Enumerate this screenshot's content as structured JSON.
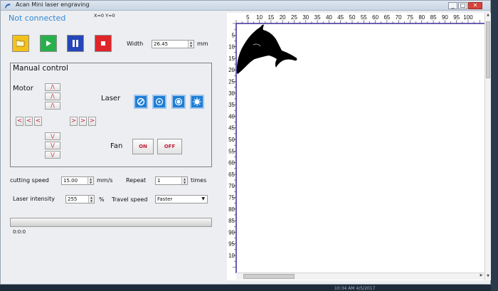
{
  "window": {
    "title": "Acan Mini laser engraving",
    "buttons": {
      "minimize": "_",
      "maximize": "□",
      "close": "✕"
    }
  },
  "status": {
    "connection": "Not connected",
    "coords": "X=0 Y=0"
  },
  "toolbar": {
    "open_icon": "folder-icon",
    "play_icon": "play-icon",
    "pause_icon": "pause-icon",
    "stop_icon": "stop-icon",
    "colors": {
      "open": "#f2c21a",
      "play": "#27b04b",
      "pause": "#2546b8",
      "stop": "#e0252a"
    }
  },
  "width": {
    "label": "Width",
    "value": "26.45",
    "unit": "mm"
  },
  "manual": {
    "title": "Manual control",
    "motor_label": "Motor",
    "laser_label": "Laser",
    "fan_label": "Fan",
    "up": "/\\",
    "down": "\\/",
    "left": "<",
    "right": ">",
    "laser_icons": [
      "laser-off-icon",
      "laser-low-icon",
      "laser-medium-icon",
      "laser-full-icon"
    ],
    "fan_on": "ON",
    "fan_off": "OFF"
  },
  "settings": {
    "cutting_speed_label": "cutting speed",
    "cutting_speed_value": "15.00",
    "cutting_speed_unit": "mm/s",
    "repeat_label": "Repeat",
    "repeat_value": "1",
    "repeat_unit": "times",
    "laser_intensity_label": "Laser intensity",
    "laser_intensity_value": "255",
    "laser_intensity_unit": "%",
    "travel_speed_label": "Travel speed",
    "travel_speed_value": "Faster"
  },
  "progress": {
    "value": 0,
    "label": "0:0:0"
  },
  "ruler": {
    "top": [
      "5",
      "10",
      "15",
      "20",
      "25",
      "30",
      "35",
      "40",
      "45",
      "50",
      "55",
      "60",
      "65",
      "70",
      "75",
      "80",
      "85",
      "90",
      "95",
      "100"
    ],
    "left": [
      "5",
      "10",
      "15",
      "20",
      "25",
      "30",
      "35",
      "40",
      "45",
      "50",
      "55",
      "60",
      "65",
      "70",
      "75",
      "80",
      "85",
      "90",
      "95",
      "10"
    ]
  },
  "preview": {
    "image": "dolphin-engraving-preview",
    "color": "#000000"
  },
  "taskbar": {
    "clock": "10:34 AM  4/5/2017"
  }
}
